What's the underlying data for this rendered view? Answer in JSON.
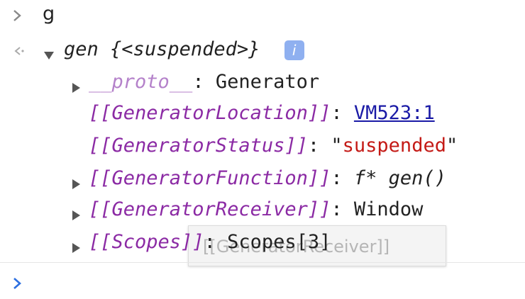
{
  "console": {
    "input": "g",
    "object_header": {
      "name": "gen",
      "state": "{<suspended>}",
      "info_badge": "i"
    },
    "properties": [
      {
        "key": "__proto__",
        "sep": ":",
        "value": "Generator"
      },
      {
        "key": "[[GeneratorLocation]]",
        "sep": ":",
        "value": "VM523:1"
      },
      {
        "key": "[[GeneratorStatus]]",
        "sep": ":",
        "value_open": "\"",
        "value": "suspended",
        "value_close": "\""
      },
      {
        "key": "[[GeneratorFunction]]",
        "sep": ":",
        "value": "f* gen()"
      },
      {
        "key": "[[GeneratorReceiver]]",
        "sep": ":",
        "value": "Window"
      },
      {
        "key": "[[Scopes]]",
        "sep": ":",
        "value": "Scopes[3]"
      }
    ],
    "tooltip": "[[GeneratorReceiver]]"
  },
  "colors": {
    "property": "#8b2aa4",
    "string": "#c41a16",
    "link": "#1a1aa6",
    "prompt": "#2d6fe0"
  }
}
